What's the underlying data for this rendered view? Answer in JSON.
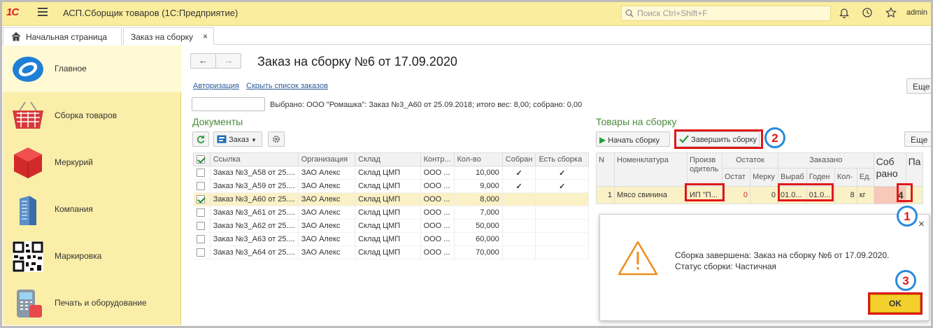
{
  "app": {
    "logo": "1С",
    "title": "АСП.Сборщик товаров  (1С:Предприятие)",
    "search_placeholder": "Поиск Ctrl+Shift+F",
    "user": "admin"
  },
  "tabs": [
    {
      "label": "Начальная страница",
      "icon": "home-icon"
    },
    {
      "label": "Заказ на сборку",
      "close": "×"
    }
  ],
  "sidebar": {
    "items": [
      {
        "label": "Главное",
        "icon": "main-logo-icon"
      },
      {
        "label": "Сборка товаров",
        "icon": "basket-icon"
      },
      {
        "label": "Меркурий",
        "icon": "cube-icon"
      },
      {
        "label": "Компания",
        "icon": "building-icon"
      },
      {
        "label": "Маркировка",
        "icon": "qr-code-icon"
      },
      {
        "label": "Печать и оборудование",
        "icon": "terminal-icon"
      }
    ]
  },
  "form": {
    "back": "←",
    "forward": "→",
    "title": "Заказ на сборку №6 от 17.09.2020",
    "link_auth": "Авторизация",
    "link_hide": "Скрыть список заказов",
    "more": "Еще",
    "more2": "Еще",
    "status_text": "Выбрано: ООО \"Ромашка\": Заказ №3_А60 от 25.09.2018; итого вес: 8,00; собрано: 0,00"
  },
  "documents": {
    "heading": "Документы",
    "order_button": "Заказ",
    "columns": [
      "Ссылка",
      "Организация",
      "Склад",
      "Контр...",
      "Кол-во",
      "Собран",
      "Есть сборка"
    ],
    "rows": [
      {
        "checked": false,
        "link": "Заказ №3_А58 от 25....",
        "org": "ЗАО Алекс",
        "warehouse": "Склад ЦМП",
        "contr": "ООО ...",
        "qty": "10,000",
        "collected": "✓",
        "has_assembly": "✓"
      },
      {
        "checked": false,
        "link": "Заказ №3_А59 от 25....",
        "org": "ЗАО Алекс",
        "warehouse": "Склад ЦМП",
        "contr": "ООО ...",
        "qty": "9,000",
        "collected": "✓",
        "has_assembly": "✓"
      },
      {
        "checked": true,
        "link": "Заказ №3_А60 от 25....",
        "org": "ЗАО Алекс",
        "warehouse": "Склад ЦМП",
        "contr": "ООО ...",
        "qty": "8,000",
        "collected": "",
        "has_assembly": ""
      },
      {
        "checked": false,
        "link": "Заказ №3_А61 от 25....",
        "org": "ЗАО Алекс",
        "warehouse": "Склад ЦМП",
        "contr": "ООО ...",
        "qty": "7,000",
        "collected": "",
        "has_assembly": ""
      },
      {
        "checked": false,
        "link": "Заказ №3_А62 от 25....",
        "org": "ЗАО Алекс",
        "warehouse": "Склад ЦМП",
        "contr": "ООО ...",
        "qty": "50,000",
        "collected": "",
        "has_assembly": ""
      },
      {
        "checked": false,
        "link": "Заказ №3_А63 от 25....",
        "org": "ЗАО Алекс",
        "warehouse": "Склад ЦМП",
        "contr": "ООО ...",
        "qty": "60,000",
        "collected": "",
        "has_assembly": ""
      },
      {
        "checked": false,
        "link": "Заказ №3_А64 от 25....",
        "org": "ЗАО Алекс",
        "warehouse": "Склад ЦМП",
        "contr": "ООО ...",
        "qty": "70,000",
        "collected": "",
        "has_assembly": ""
      }
    ]
  },
  "goods": {
    "heading": "Товары на сборку",
    "start_button": "Начать сборку",
    "finish_button": "Завершить сборку",
    "col_n": "N",
    "col_name": "Номенклатура",
    "col_maker": "Произв одитель",
    "col_remainder": "Остаток",
    "col_ordered": "Заказано",
    "col_collected": "Соб рано",
    "col_pa": "Па",
    "sub_ostat": "Остат",
    "sub_merku": "Мерку",
    "sub_vyrab": "Выраб",
    "sub_goden": "Годен",
    "sub_kol": "Кол-",
    "sub_ed": "Ед.",
    "row": {
      "n": "1",
      "name": "Мясо свинина",
      "maker": "ИП \"П...",
      "ostat": "0",
      "merku": "0",
      "vyrab": "01.0...",
      "goden": "01.0...",
      "kol": "8",
      "ed": "кг",
      "collected": "4"
    }
  },
  "dialog": {
    "line1": "Сборка завершена: Заказ на сборку №6 от 17.09.2020.",
    "line2": "Статус сборки: Частичная",
    "ok": "OK",
    "close": "×"
  },
  "annotations": {
    "step1": "1",
    "step2": "2",
    "step3": "3"
  },
  "colors": {
    "topbar": "#fbed9e",
    "sidebar": "#fbeea9",
    "accent_green": "#4a8a3a",
    "highlight_red": "#e01818",
    "badge_blue": "#2a8adc",
    "ok_yellow": "#f3d02b"
  }
}
